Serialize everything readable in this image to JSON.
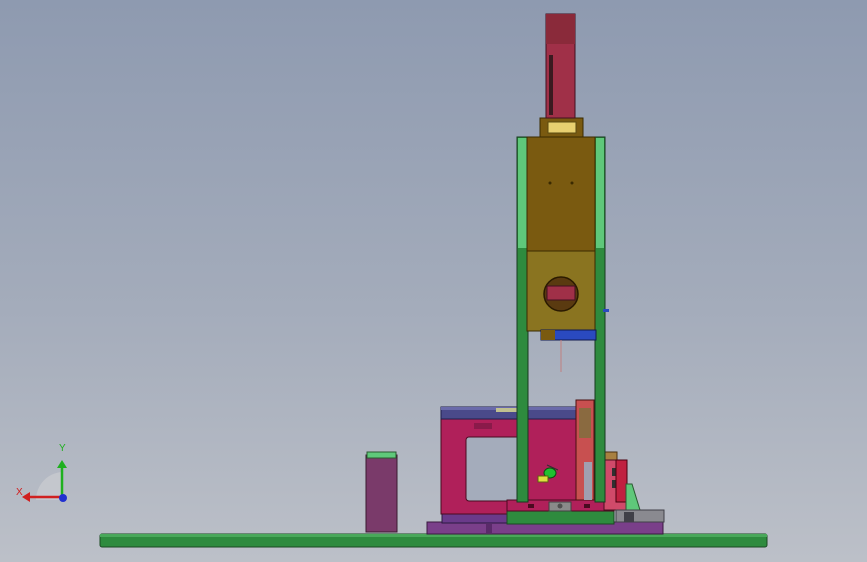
{
  "triad": {
    "x_label": "X",
    "y_label": "Y",
    "x_color": "#d02020",
    "y_color": "#1fb01f",
    "z_color": "#2030d0"
  },
  "colors": {
    "background_top": "#8e9ab0",
    "background_bottom": "#bcc0c8",
    "base_plate": "#2e8b3e",
    "frame_green": "#5fc87a",
    "motor_red": "#a03048",
    "housing_olive": "#7a5a10",
    "press_magenta": "#b0205a",
    "cylinder_purple": "#7a3a6a"
  }
}
